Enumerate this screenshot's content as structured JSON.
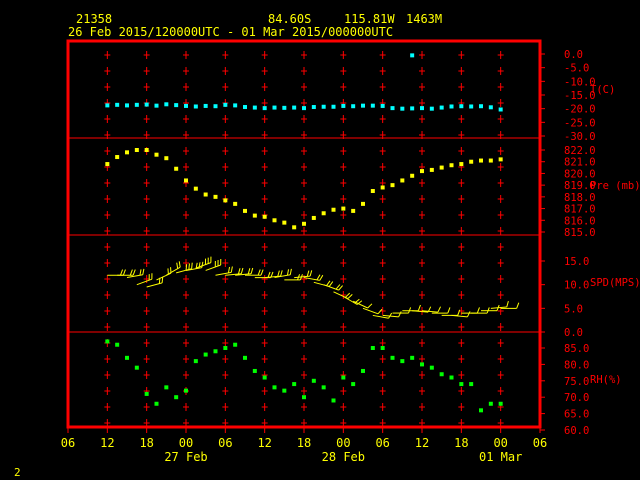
{
  "header": {
    "station": "21358",
    "lat": "84.60S",
    "lon": "115.81W",
    "elev": "1463M",
    "period": "26 Feb 2015/120000UTC - 01 Mar 2015/000000UTC"
  },
  "page_number": "2",
  "colors": {
    "frame": "#ff0000",
    "text": "#ffff00",
    "temp": "#00ffff",
    "pres": "#ffff00",
    "wind": "#ffff00",
    "rh": "#00ff00"
  },
  "chart_data": {
    "type": "scatter",
    "x_axis": {
      "unit": "hours since 26 Feb 2015 06UTC",
      "range": [
        0,
        72
      ],
      "tick_labels": [
        "06",
        "12",
        "18",
        "00",
        "06",
        "12",
        "18",
        "00",
        "06",
        "12",
        "18",
        "00",
        "06"
      ],
      "date_labels": [
        {
          "hour": 18,
          "text": "27 Feb"
        },
        {
          "hour": 42,
          "text": "28 Feb"
        },
        {
          "hour": 66,
          "text": "01 Mar"
        }
      ]
    },
    "panels": [
      {
        "id": "temp",
        "label": "T(C)",
        "range": [
          -30,
          0
        ],
        "tick_labels": [
          "0.0",
          "-5.0",
          "-10.0",
          "-15.0",
          "-20.0",
          "-25.0",
          "-30.0"
        ],
        "x": [
          6,
          7.5,
          9,
          10.5,
          12,
          13.5,
          15,
          16.5,
          18,
          19.5,
          21,
          22.5,
          24,
          25.5,
          27,
          28.5,
          30,
          31.5,
          33,
          34.5,
          36,
          37.5,
          39,
          40.5,
          42,
          43.5,
          45,
          46.5,
          48,
          49.5,
          51,
          52.5,
          54,
          55.5,
          57,
          58.5,
          60,
          61.5,
          63,
          64.5,
          66
        ],
        "y": [
          -18.8,
          -18.6,
          -18.8,
          -18.6,
          -18.5,
          -18.9,
          -18.4,
          -18.7,
          -19.0,
          -19.2,
          -19.0,
          -19.1,
          -18.6,
          -18.8,
          -19.4,
          -19.6,
          -19.8,
          -19.6,
          -19.7,
          -19.6,
          -19.8,
          -19.4,
          -19.3,
          -19.3,
          -19.0,
          -19.1,
          -18.9,
          -18.9,
          -19.0,
          -19.8,
          -20.0,
          -19.9,
          -19.8,
          -20.0,
          -19.6,
          -19.2,
          -19.1,
          -19.2,
          -19.1,
          -19.5,
          -20.3
        ],
        "outliers": [
          {
            "x": 52.5,
            "y": -0.5
          }
        ]
      },
      {
        "id": "pres",
        "label": "Pre (mb)",
        "range": [
          815,
          823
        ],
        "tick_labels": [
          "822.0",
          "821.0",
          "820.0",
          "819.0",
          "818.0",
          "817.0",
          "816.0",
          "815.0"
        ],
        "x": [
          6,
          7.5,
          9,
          10.5,
          12,
          13.5,
          15,
          16.5,
          18,
          19.5,
          21,
          22.5,
          24,
          25.5,
          27,
          28.5,
          30,
          31.5,
          33,
          34.5,
          36,
          37.5,
          39,
          40.5,
          42,
          43.5,
          45,
          46.5,
          48,
          49.5,
          51,
          52.5,
          54,
          55.5,
          57,
          58.5,
          60,
          61.5,
          63,
          64.5,
          66
        ],
        "y": [
          820.8,
          821.4,
          821.8,
          822.0,
          822.0,
          821.6,
          821.3,
          820.4,
          819.4,
          818.7,
          818.2,
          818.0,
          817.7,
          817.4,
          816.8,
          816.4,
          816.3,
          816.0,
          815.8,
          815.4,
          815.7,
          816.2,
          816.6,
          816.9,
          817.0,
          816.8,
          817.4,
          818.5,
          818.8,
          819.0,
          819.4,
          819.8,
          820.2,
          820.3,
          820.5,
          820.7,
          820.8,
          821.0,
          821.1,
          821.1,
          821.2
        ]
      },
      {
        "id": "wind",
        "label": "SPD(MPS)",
        "range": [
          0,
          15
        ],
        "tick_labels": [
          "15.0",
          "10.0",
          "5.0",
          "0.0"
        ],
        "x": [
          6,
          7.5,
          9,
          10.5,
          12,
          13.5,
          15,
          16.5,
          18,
          19.5,
          21,
          22.5,
          24,
          25.5,
          27,
          28.5,
          30,
          31.5,
          33,
          34.5,
          36,
          37.5,
          39,
          40.5,
          42,
          43.5,
          45,
          46.5,
          48,
          49.5,
          51,
          52.5,
          54,
          55.5,
          57,
          58.5,
          60,
          61.5,
          63,
          64.5,
          66
        ],
        "y": [
          12.0,
          12.0,
          11.5,
          10.0,
          9.5,
          11.0,
          12.0,
          12.5,
          13.0,
          13.5,
          13.0,
          12.0,
          12.0,
          12.0,
          12.0,
          11.5,
          11.5,
          11.5,
          11.0,
          11.5,
          11.5,
          10.5,
          10.0,
          8.5,
          7.5,
          6.5,
          5.0,
          3.5,
          3.5,
          4.0,
          4.5,
          4.5,
          4.5,
          4.0,
          3.5,
          3.5,
          4.0,
          4.0,
          4.5,
          5.0,
          5.0
        ],
        "dir_deg": [
          90,
          90,
          80,
          70,
          75,
          65,
          60,
          75,
          80,
          70,
          70,
          80,
          85,
          85,
          90,
          90,
          85,
          80,
          90,
          85,
          100,
          105,
          110,
          115,
          120,
          115,
          110,
          100,
          95,
          90,
          90,
          95,
          95,
          90,
          90,
          95,
          90,
          90,
          90,
          85,
          90
        ]
      },
      {
        "id": "rh",
        "label": "RH(%)",
        "range": [
          60,
          90
        ],
        "tick_labels": [
          "85.0",
          "80.0",
          "75.0",
          "70.0",
          "65.0",
          "60.0"
        ],
        "x": [
          6,
          7.5,
          9,
          10.5,
          12,
          13.5,
          15,
          16.5,
          18,
          19.5,
          21,
          22.5,
          24,
          25.5,
          27,
          28.5,
          30,
          31.5,
          33,
          34.5,
          36,
          37.5,
          39,
          40.5,
          42,
          43.5,
          45,
          46.5,
          48,
          49.5,
          51,
          52.5,
          54,
          55.5,
          57,
          58.5,
          60,
          61.5,
          63,
          64.5,
          66
        ],
        "y": [
          87,
          86,
          82,
          79,
          71,
          68,
          73,
          70,
          72,
          81,
          83,
          84,
          85,
          86,
          82,
          78,
          76,
          73,
          72,
          74,
          70,
          75,
          73,
          69,
          76,
          74,
          78,
          85,
          85,
          82,
          81,
          82,
          80,
          79,
          77,
          76,
          74,
          74,
          66,
          68,
          68
        ]
      }
    ]
  }
}
